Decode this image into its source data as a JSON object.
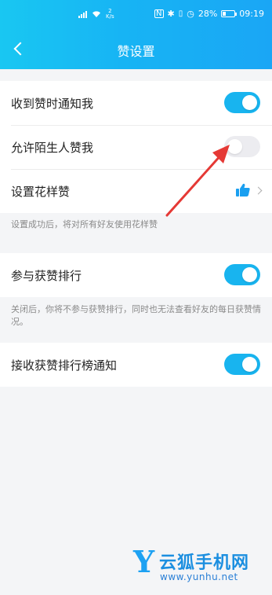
{
  "colors": {
    "accent": "#18b4ef",
    "toggle_off": "#ececf0",
    "arrow": "#e53935",
    "watermark": "#1da1f2"
  },
  "status": {
    "net_speed_value": "2",
    "net_speed_unit": "K/s",
    "battery_text": "28%",
    "time": "09:19",
    "icons": [
      "signal-icon",
      "wifi-icon",
      "nfc-icon",
      "bluetooth-icon",
      "vibrate-icon",
      "alarm-icon",
      "battery-icon"
    ]
  },
  "nav": {
    "title": "赞设置"
  },
  "section1": {
    "rows": [
      {
        "label": "收到赞时通知我",
        "toggle": true
      },
      {
        "label": "允许陌生人赞我",
        "toggle": false
      },
      {
        "label": "设置花样赞",
        "icon": "thumbs-up-icon"
      }
    ],
    "note": "设置成功后，将对所有好友使用花样赞"
  },
  "section2": {
    "rows": [
      {
        "label": "参与获赞排行",
        "toggle": true
      }
    ],
    "note": "关闭后，你将不参与获赞排行，同时也无法查看好友的每日获赞情况。"
  },
  "section3": {
    "rows": [
      {
        "label": "接收获赞排行榜通知",
        "toggle": true
      }
    ]
  },
  "watermark": {
    "letter": "Y",
    "name": "云狐手机网",
    "url": "www.yunhu.net"
  }
}
